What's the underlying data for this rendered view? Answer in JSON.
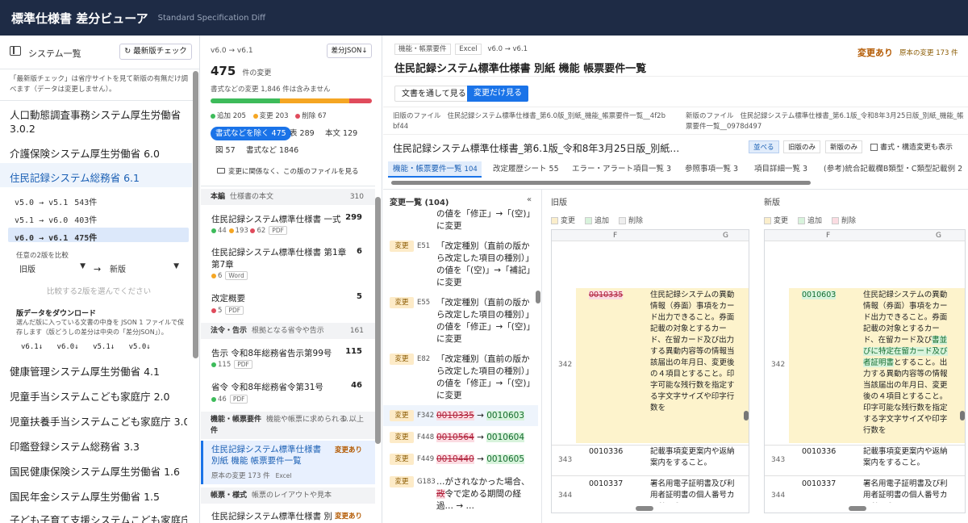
{
  "app": {
    "title": "標準仕様書 差分ビューア",
    "subtitle": "Standard Specification Diff"
  },
  "sidebar": {
    "title": "システム一覧",
    "check_button": "最新版チェック",
    "note": "「最新版チェック」は省庁サイトを見て新版の有無だけ調べます（データは変更しません）。",
    "systems": [
      "人口動態調査事務システム厚生労働省 3.0.2",
      "介護保険システム厚生労働省 6.0",
      "住民記録システム総務省 6.1",
      "健康管理システム厚生労働省 4.1",
      "児童手当システムこども家庭庁 2.0",
      "児童扶養手当システムこども家庭庁 3.0",
      "印鑑登録システム総務省 3.3",
      "国民健康保険システム厚生労働省 1.6",
      "国民年金システム厚生労働省 1.5",
      "子ども子育て支援システムこども家庭庁"
    ],
    "versions": [
      {
        "range": "v5.0 → v5.1",
        "count": "543件"
      },
      {
        "range": "v5.1 → v6.0",
        "count": "403件"
      },
      {
        "range": "v6.0 → v6.1",
        "count": "475件"
      }
    ],
    "compare_label": "任意の2版を比較",
    "old_select": "旧版",
    "new_select": "新版",
    "compare_hint": "比較する2版を選んでください",
    "download_title": "版データをダウンロード",
    "download_note": "選んだ版に入っている文書の中身を JSON 1 ファイルで保存します（版どうしの差分は中央の「差分JSON」）。",
    "download_links": [
      "v6.1",
      "v6.0",
      "v5.1",
      "v5.0"
    ]
  },
  "list": {
    "range": "v6.0 → v6.1",
    "json_button": "差分JSON",
    "count": "475",
    "count_unit": "件の変更",
    "note": "書式などの変更 1,846 件は含みません",
    "bar": {
      "add": 205,
      "change": 203,
      "delete": 67
    },
    "legend": {
      "add": "追加 205",
      "change": "変更 203",
      "delete": "削除 67"
    },
    "filters": [
      "書式などを除く 475",
      "表 289",
      "本文 129",
      "図 57",
      "書式など 1846"
    ],
    "show_files": "変更に関係なく、この版のファイルを見る",
    "sections": [
      {
        "name": "本編",
        "desc": "仕様書の本文",
        "count": "310"
      },
      {
        "name": "法令・告示",
        "desc": "根拠となる省令や告示",
        "count": "161"
      },
      {
        "name": "機能・帳票要件",
        "desc": "機能や帳票に求められる…",
        "count": "0 以上"
      },
      {
        "name": "帳票・様式",
        "desc": "帳票のレイアウトや見本",
        "count": ""
      }
    ],
    "files": [
      {
        "name": "住民記録システム標準仕様書 一式",
        "count": "299",
        "a": "44",
        "c": "193",
        "d": "62",
        "type": "PDF"
      },
      {
        "name": "住民記録システム標準仕様書 第1章 第7章",
        "count": "6",
        "c": "6",
        "type": "Word"
      },
      {
        "name": "改定概要",
        "count": "5",
        "d": "5",
        "type": "PDF"
      },
      {
        "name": "告示 令和8年総務省告示第99号",
        "count": "115",
        "a": "115",
        "type": "PDF"
      },
      {
        "name": "省令 令和8年総務省令第31号",
        "count": "46",
        "a": "46",
        "type": "PDF"
      },
      {
        "name": "住民記録システム標準仕様書 別紙 機能 帳票要件一覧",
        "status": "変更あり",
        "meta": "原本の変更 173 件",
        "type": "Excel"
      },
      {
        "name": "住民記録システム標準仕様書 別",
        "status": "変更あり"
      }
    ],
    "section_suffix": "件"
  },
  "main": {
    "tags": [
      "機能・帳票要件",
      "Excel",
      "v6.0 → v6.1"
    ],
    "title": "住民記録システム標準仕様書 別紙 機能 帳票要件一覧",
    "status": "変更あり",
    "status_note": "原本の変更 173 件",
    "view_tabs": [
      "文書を通して見る",
      "変更だけ見る"
    ],
    "old_file_label": "旧版のファイル",
    "old_file": "住民記録システム標準仕様書_第6.0版_別紙_機能_帳票要件一覧__4f2bbf44",
    "new_file_label": "新版のファイル",
    "new_file": "住民記録システム標準仕様書_第6.1版_令和8年3月25日版_別紙_機能_帳票要件一覧__0978d497",
    "doc_title": "住民記録システム標準仕様書_第6.1版_令和8年3月25日版_別紙…",
    "mode_buttons": [
      "並べる",
      "旧版のみ",
      "新版のみ"
    ],
    "format_toggle": "書式・構造変更も表示",
    "sheet_tabs": [
      {
        "name": "機能・帳票要件一覧",
        "n": "104"
      },
      {
        "name": "改定履歴シート",
        "n": "55"
      },
      {
        "name": "エラー・アラート項目一覧",
        "n": "3"
      },
      {
        "name": "参照事項一覧",
        "n": "3"
      },
      {
        "name": "項目詳細一覧",
        "n": "3"
      },
      {
        "name": "(参考)統合記載欄B類型・C類型記載例",
        "n": "2"
      }
    ],
    "changes_title": "変更一覧 (104)",
    "collapse": "«",
    "changes": [
      {
        "tag": "変更",
        "ref": "E51",
        "text": "「改定種別（直前の版から改定した項目の種別）」の値を「(空)」→「補記」に変更"
      },
      {
        "tag": "変更",
        "ref": "E55",
        "text": "「改定種別（直前の版から改定した項目の種別）」の値を「修正」→「(空)」に変更"
      },
      {
        "tag": "変更",
        "ref": "E82",
        "text": "「改定種別（直前の版から改定した項目の種別）」の値を「修正」→「(空)」に変更"
      }
    ],
    "changes_top": "の値を「修正」→「(空)」に変更",
    "ids": [
      {
        "tag": "変更",
        "ref": "F342",
        "old": "0010335",
        "new": "0010603"
      },
      {
        "tag": "変更",
        "ref": "F448",
        "old": "0010564",
        "new": "0010604"
      },
      {
        "tag": "変更",
        "ref": "F449",
        "old": "0010440",
        "new": "0010605"
      }
    ],
    "last_change": {
      "tag": "変更",
      "ref": "G183",
      "a": "…がされなかった場合、",
      "del": "政",
      "b": "令で定める期間の経過… → …"
    },
    "old_pane": "旧版",
    "new_pane": "新版",
    "legend": [
      "変更",
      "追加",
      "削除"
    ],
    "col_f": "F",
    "col_g": "G",
    "rows": {
      "r342": "342",
      "r343": "343",
      "r344": "344"
    },
    "old_ids": [
      "0010335",
      "0010336",
      "0010337"
    ],
    "new_ids": [
      "0010603",
      "0010336",
      "0010337"
    ],
    "g342_old": "住民記録システムの異動情報（券面）事項をカード出力できること。券面記載の対象とするカード、在留カード及び出力する異動内容等の情報当該届出の年月日、変更後の４項目とすること。印字可能な残行数を指定する字文字サイズや印字行数を",
    "g342_new_a": "住民記録システムの異動情報（券面）事項をカード出力できること。券面記載の対象とするカード、在留カード及び",
    "g342_new_add": "書並びに特定在留カード及び者証明書",
    "g342_new_b": "とすること。出力する異動内容等の情報当該届出の年月日、変更後の４項目とすること。印字可能な残行数を指定する字文字サイズや印字行数を",
    "g343": "記載事項変更案内や返納案内をすること。",
    "g344": "署名用電子証明書及び利用者証明書の個人番号カードへの"
  },
  "colors": {
    "header": "#1e2b45",
    "accent": "#1a73e8",
    "change": "#f5a623",
    "add": "#3dbb5a",
    "delete": "#e04b5c",
    "selected": "#e8f0fe"
  }
}
